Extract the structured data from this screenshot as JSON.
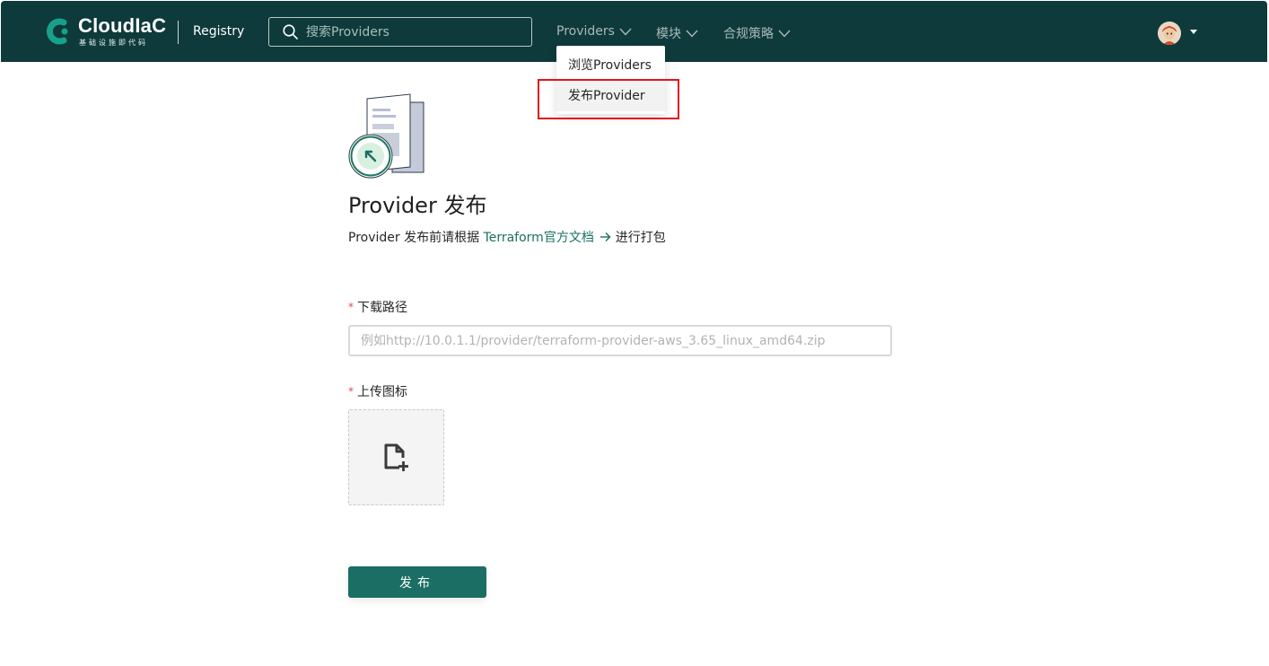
{
  "header": {
    "brand_name": "CloudIaC",
    "brand_subtitle": "基础设施即代码",
    "registry_label": "Registry",
    "search_placeholder": "搜索Providers",
    "nav": [
      {
        "label": "Providers"
      },
      {
        "label": "模块"
      },
      {
        "label": "合规策略"
      }
    ]
  },
  "dropdown": {
    "items": [
      {
        "label": "浏览Providers"
      },
      {
        "label": "发布Provider"
      }
    ]
  },
  "page": {
    "title": "Provider 发布",
    "subtitle_prefix": "Provider 发布前请根据",
    "docs_link": "Terraform官方文档",
    "subtitle_suffix": "进行打包",
    "download_label": "下载路径",
    "download_placeholder": "例如http://10.0.1.1/provider/terraform-provider-aws_3.65_linux_amd64.zip",
    "icon_label": "上传图标",
    "required_mark": "*",
    "submit_label": "发布"
  },
  "colors": {
    "topbar": "#0e3a3c",
    "accent": "#1b6e64",
    "link": "#1a6f63",
    "highlight": "#e4141b"
  },
  "icons": [
    "cloudiac-logo-icon",
    "search-icon",
    "chevron-down-icon",
    "avatar-icon",
    "caret-down-icon",
    "arrow-right-icon",
    "provider-publish-illustration",
    "file-add-icon"
  ]
}
